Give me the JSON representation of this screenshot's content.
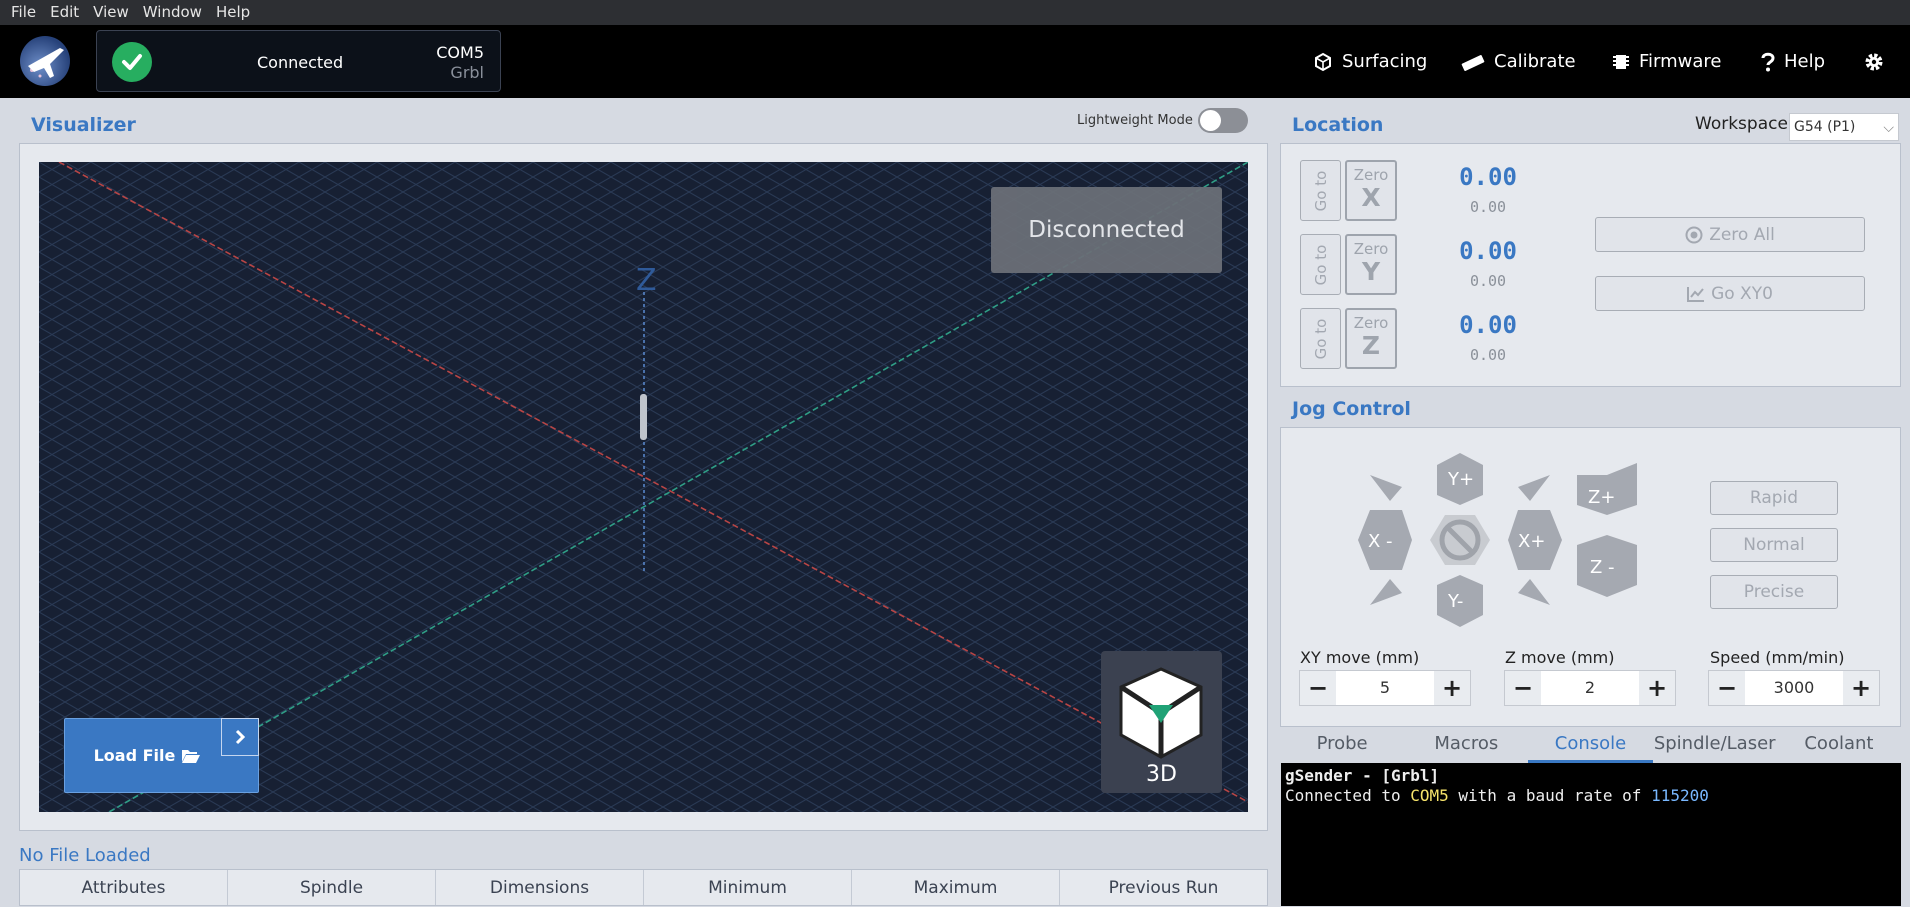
{
  "menubar": {
    "items": [
      "File",
      "Edit",
      "View",
      "Window",
      "Help"
    ]
  },
  "header": {
    "connection": {
      "status": "Connected",
      "port": "COM5",
      "firmware": "Grbl"
    },
    "nav": [
      {
        "label": "Surfacing",
        "icon": "surfacing-icon"
      },
      {
        "label": "Calibrate",
        "icon": "ruler-icon"
      },
      {
        "label": "Firmware",
        "icon": "chip-icon"
      },
      {
        "label": "Help",
        "icon": "question-icon"
      }
    ],
    "settings_icon": "gear-icon"
  },
  "visualizer": {
    "title": "Visualizer",
    "lightweight_label": "Lightweight Mode",
    "lightweight_on": false,
    "status_overlay": "Disconnected",
    "axis_z_label": "Z",
    "load_file_label": "Load File",
    "view_mode_label": "3D"
  },
  "file_info": {
    "status": "No File Loaded",
    "tabs": [
      "Attributes",
      "Spindle",
      "Dimensions",
      "Minimum",
      "Maximum",
      "Previous Run"
    ]
  },
  "location": {
    "title": "Location",
    "workspace_label": "Workspace:",
    "workspace_value": "G54 (P1)",
    "goto_label": "Go to",
    "zero_label": "Zero",
    "axes": [
      {
        "axis": "X",
        "work": "0.00",
        "machine": "0.00"
      },
      {
        "axis": "Y",
        "work": "0.00",
        "machine": "0.00"
      },
      {
        "axis": "Z",
        "work": "0.00",
        "machine": "0.00"
      }
    ],
    "zero_all_label": "Zero All",
    "go_xy0_label": "Go  XY0"
  },
  "jog": {
    "title": "Jog Control",
    "buttons": {
      "y_plus": "Y+",
      "y_minus": "Y-",
      "x_plus": "X+",
      "x_minus": "X -",
      "z_plus": "Z+",
      "z_minus": "Z -"
    },
    "speeds": [
      "Rapid",
      "Normal",
      "Precise"
    ],
    "xy_move": {
      "label": "XY move (mm)",
      "value": "5"
    },
    "z_move": {
      "label": "Z move (mm)",
      "value": "2"
    },
    "speed": {
      "label": "Speed (mm/min)",
      "value": "3000"
    }
  },
  "bottom_tabs": {
    "items": [
      "Probe",
      "Macros",
      "Console",
      "Spindle/Laser",
      "Coolant"
    ],
    "active": "Console"
  },
  "console": {
    "line1": "gSender - [Grbl]",
    "line2_prefix": "Connected to ",
    "line2_port": "COM5",
    "line2_mid": " with a baud rate of ",
    "line2_baud": "115200"
  },
  "colors": {
    "accent": "#3a78c3",
    "success": "#27ae60",
    "viz_bg": "#172033"
  }
}
